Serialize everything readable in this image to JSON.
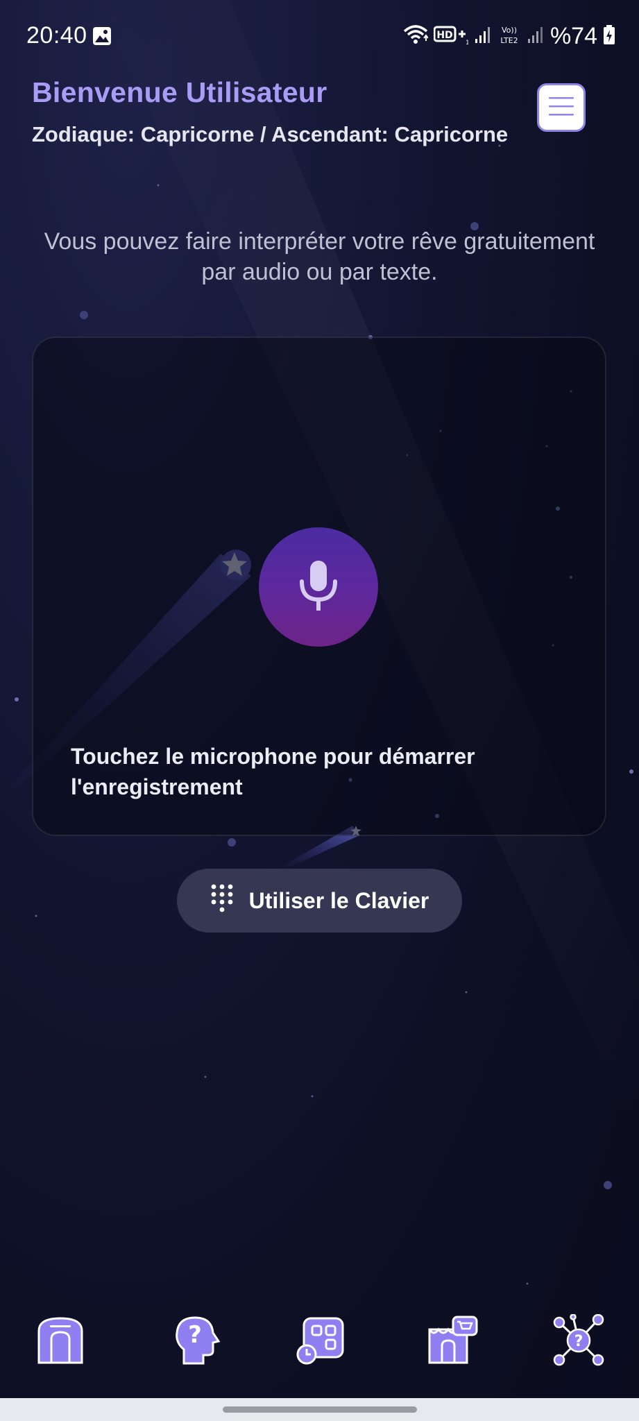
{
  "status_bar": {
    "time": "20:40",
    "battery_level": "%74",
    "icons": [
      "gallery-icon",
      "wifi-icon",
      "hd-plus-icon",
      "signal-icon",
      "volte-lte2-icon",
      "signal-icon",
      "battery-charging-icon"
    ]
  },
  "header": {
    "title": "Bienvenue Utilisateur",
    "subtitle": "Zodiaque: Capricorne / Ascendant: Capricorne",
    "menu_icon": "hamburger-menu-icon"
  },
  "intro": {
    "text": "Vous pouvez faire interpréter votre rêve gratuitement par audio ou par texte."
  },
  "record_card": {
    "mic_icon": "microphone-icon",
    "hint": "Touchez le microphone pour démarrer l'enregistrement"
  },
  "keyboard_button": {
    "label": "Utiliser le Clavier",
    "icon": "keypad-icon"
  },
  "bottom_nav": {
    "items": [
      {
        "icon": "home-icon"
      },
      {
        "icon": "head-question-icon"
      },
      {
        "icon": "apps-clock-icon"
      },
      {
        "icon": "shop-icon"
      },
      {
        "icon": "network-question-icon"
      }
    ]
  },
  "colors": {
    "accent": "#a99cf6",
    "nav_icon": "#8f7ff0",
    "mic_top": "#4b2ca0",
    "mic_bottom": "#6e2488",
    "keyboard_button_bg": "#353753",
    "background": "#0c0e22"
  }
}
